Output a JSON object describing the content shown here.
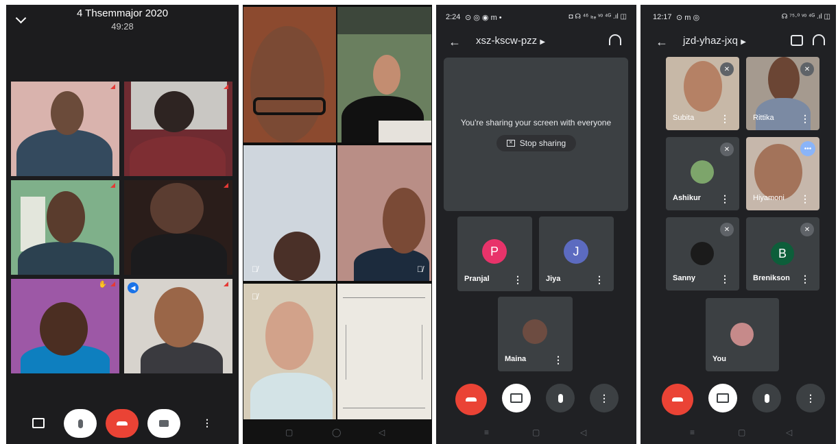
{
  "panel1": {
    "title": "4 Thsemmajor 2020",
    "timer": "49:28"
  },
  "panel3": {
    "status_time": "2:24",
    "status_icons": "⊙ ◎ ◉ m •",
    "status_right": "◘ ☊ ⁴⁶ ₗₜₑ ᵛᵒ ⁴ᴳ .ıl ◫",
    "meeting_code": "xsz-kscw-pzz",
    "share_message": "You're sharing your screen with everyone",
    "stop_sharing_label": "Stop sharing",
    "participants": [
      {
        "name": "Pranjal",
        "initial": "P",
        "color": "#e8336a"
      },
      {
        "name": "Jiya",
        "initial": "J",
        "color": "#5c6bc0"
      },
      {
        "name": "Maina",
        "initial": "",
        "color": "#6d4c41"
      }
    ]
  },
  "panel4": {
    "status_time": "12:17",
    "status_icons": "⊙ m ◎",
    "status_right": "☊ ⁷⁵·⁰ ᵛᵒ ⁴ᴳ .ıl ◫",
    "meeting_code": "jzd-yhaz-jxq",
    "participants": [
      {
        "name": "Subita"
      },
      {
        "name": "Rittika"
      },
      {
        "name": "Ashikur"
      },
      {
        "name": "Hiyamoni"
      },
      {
        "name": "Sanny"
      },
      {
        "name": "Brenikson",
        "initial": "B",
        "color": "#0d5e3a"
      },
      {
        "name": "You"
      }
    ]
  },
  "icons": {
    "chat": "chat-icon",
    "mic": "mic-icon",
    "end_call": "end-call-icon",
    "camera": "camera-icon",
    "more": "more-vert-icon",
    "headset": "headset-icon",
    "switch_camera": "switch-camera-icon",
    "mic_off": "mic-off-icon",
    "camera_off": "camera-off-icon"
  },
  "colors": {
    "end_call_red": "#ea4335",
    "meet_dark": "#202124",
    "tile_grey": "#3c4043"
  }
}
